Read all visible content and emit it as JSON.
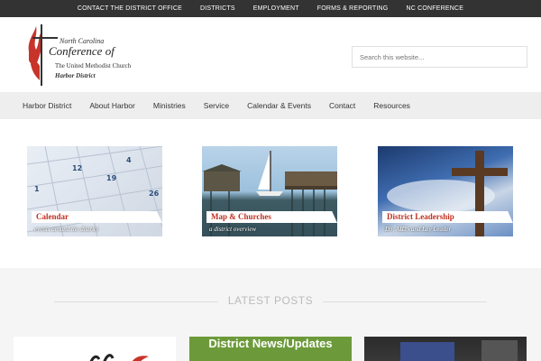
{
  "topbar": {
    "items": [
      "Contact the District Office",
      "Districts",
      "Employment",
      "Forms & Reporting",
      "NC Conference"
    ]
  },
  "logo": {
    "line1": "North Carolina",
    "line2": "Conference of",
    "line3": "The United Methodist Church",
    "line4": "Harbor District",
    "cross_color": "#333333",
    "flame_color": "#c8332a"
  },
  "search": {
    "placeholder": "Search this website..."
  },
  "nav": {
    "items": [
      "Harbor District",
      "About Harbor",
      "Ministries",
      "Service",
      "Calendar & Events",
      "Contact",
      "Resources"
    ]
  },
  "features": [
    {
      "title": "Calendar",
      "subtitle": "events around the district",
      "icon": "calendar-image"
    },
    {
      "title": "Map & Churches",
      "subtitle": "a district overview",
      "icon": "harbor-image"
    },
    {
      "title": "District Leadership",
      "subtitle": "DS, AIDS and Lay Leader",
      "icon": "cross-image"
    }
  ],
  "latest": {
    "heading": "LATEST POSTS",
    "posts": [
      {
        "label": ""
      },
      {
        "label": "District News/Updates"
      },
      {
        "label": ""
      }
    ]
  },
  "colors": {
    "accent_red": "#c03020",
    "topbar_bg": "#333333",
    "nav_bg": "#eeeeee",
    "post_green": "#6c9a3a"
  }
}
